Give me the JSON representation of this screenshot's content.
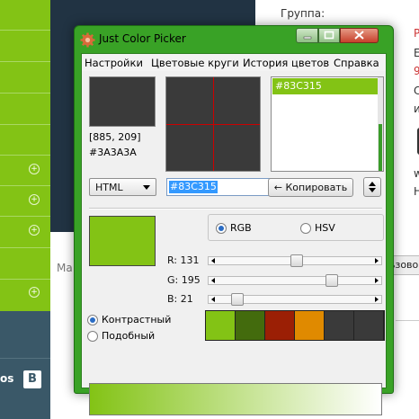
{
  "background": {
    "footer_text": "os",
    "vk_label": "B",
    "ma_text": "Ma",
    "group_label": "Группа:",
    "side_letters": [
      "P",
      "E",
      "9",
      "C",
      "и",
      "w",
      "H"
    ],
    "button_text": "ьзово"
  },
  "window": {
    "title": "Just Color Picker",
    "menu": [
      "Настройки",
      "Цветовые круги",
      "История цветов",
      "Справка"
    ],
    "coords": "[885, 209]",
    "hex_under_cursor": "#3A3A3A",
    "history": [
      "#83C315"
    ],
    "format_value": "HTML",
    "hex_input": "#83C315",
    "copy_label": "← Копировать",
    "model": {
      "rgb_label": "RGB",
      "hsv_label": "HSV",
      "selected": "RGB"
    },
    "sliders": [
      {
        "label": "R: 131",
        "value": 131,
        "max": 255
      },
      {
        "label": "G: 195",
        "value": 195,
        "max": 255
      },
      {
        "label": "B: 21",
        "value": 21,
        "max": 255
      }
    ],
    "scheme": {
      "contrast_label": "Контрастный",
      "similar_label": "Подобный",
      "selected": "Контрастный"
    },
    "palette": [
      "#83C315",
      "#436B0D",
      "#9B1F05",
      "#E08A00",
      "#3A3A3A",
      "#3A3A3A"
    ],
    "colors": {
      "accent": "#83C315",
      "preview_gray": "#3A3A3A",
      "crosshair": "#CC0000",
      "window_frame": "#39A226"
    },
    "icons": {
      "app": "gear-icon",
      "minimize": "minimize-icon",
      "maximize": "maximize-icon",
      "close": "close-icon"
    }
  }
}
